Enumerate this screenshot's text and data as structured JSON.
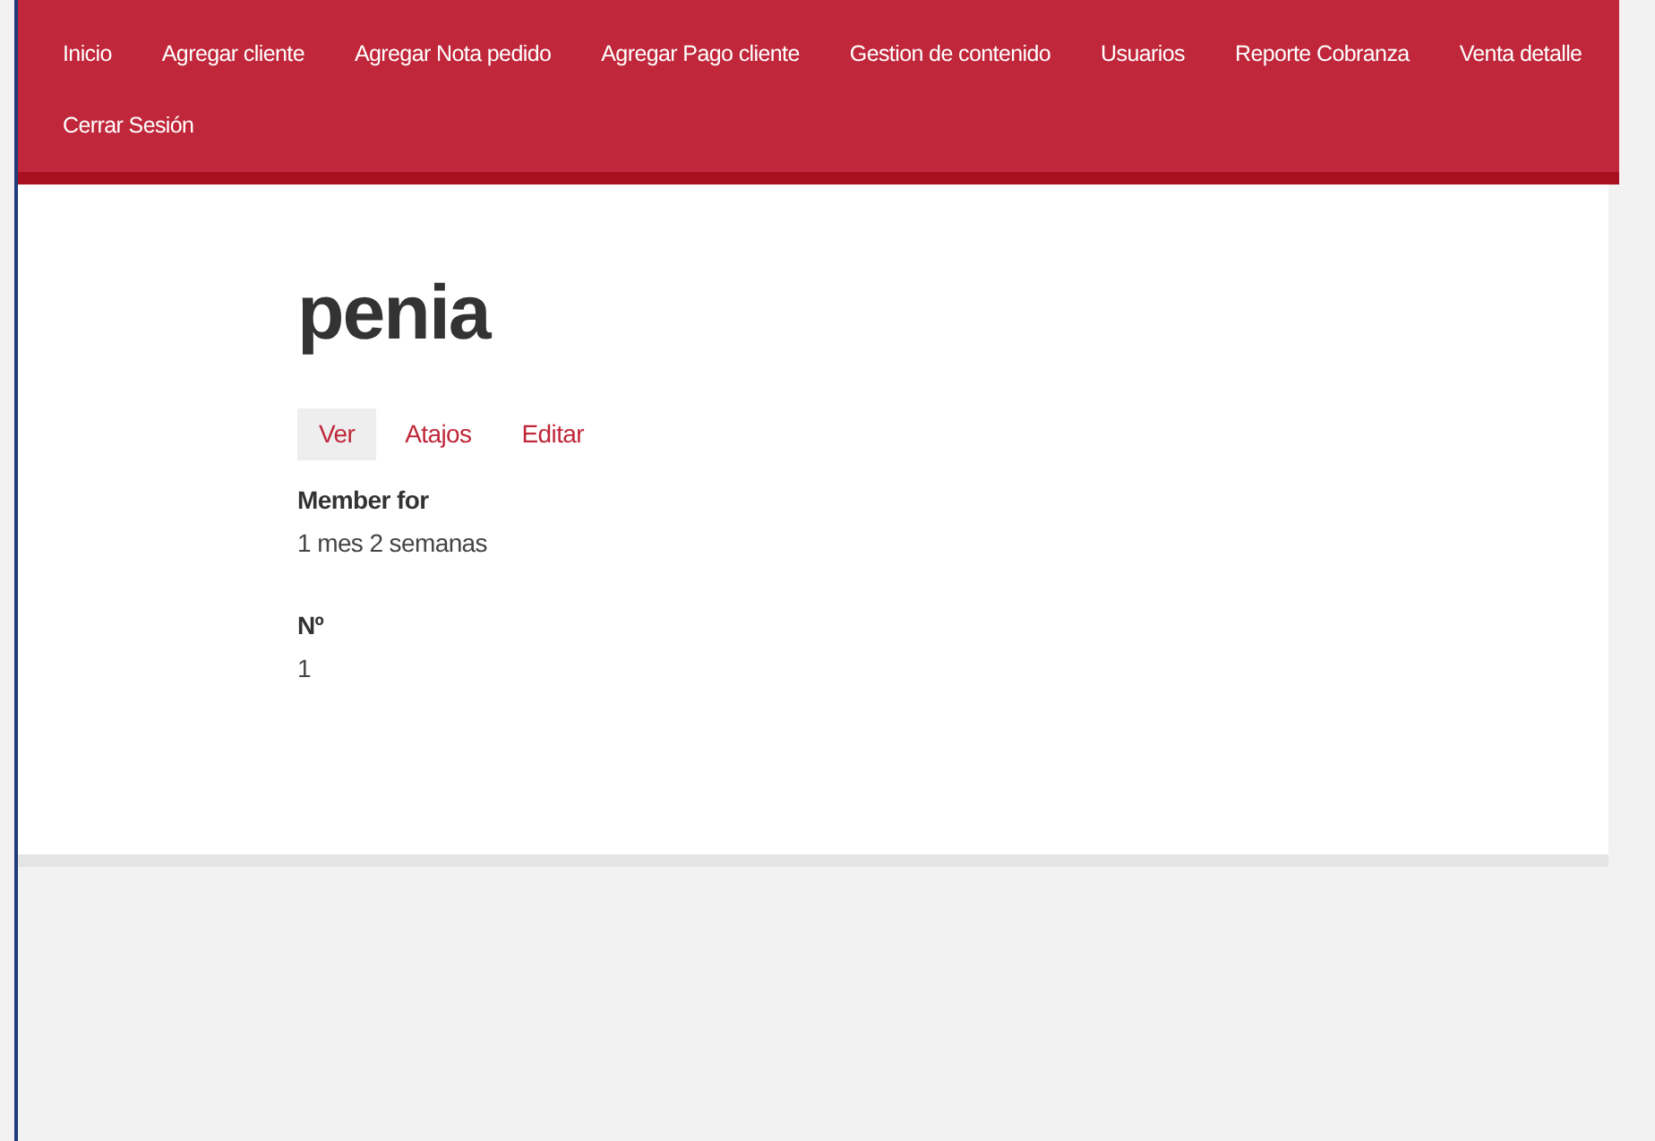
{
  "nav": {
    "items": [
      {
        "label": "Inicio"
      },
      {
        "label": "Agregar cliente"
      },
      {
        "label": "Agregar Nota pedido"
      },
      {
        "label": "Agregar Pago cliente"
      },
      {
        "label": "Gestion de contenido"
      },
      {
        "label": "Usuarios"
      },
      {
        "label": "Reporte Cobranza"
      },
      {
        "label": "Venta detalle"
      },
      {
        "label": "Cerrar Sesión"
      }
    ]
  },
  "page_title": "penia",
  "tabs": [
    {
      "label": "Ver",
      "selected": true
    },
    {
      "label": "Atajos",
      "selected": false
    },
    {
      "label": "Editar",
      "selected": false
    }
  ],
  "fields": [
    {
      "label": "Member for",
      "value": "1 mes 2 semanas"
    },
    {
      "label": "Nº",
      "value": "1"
    }
  ]
}
